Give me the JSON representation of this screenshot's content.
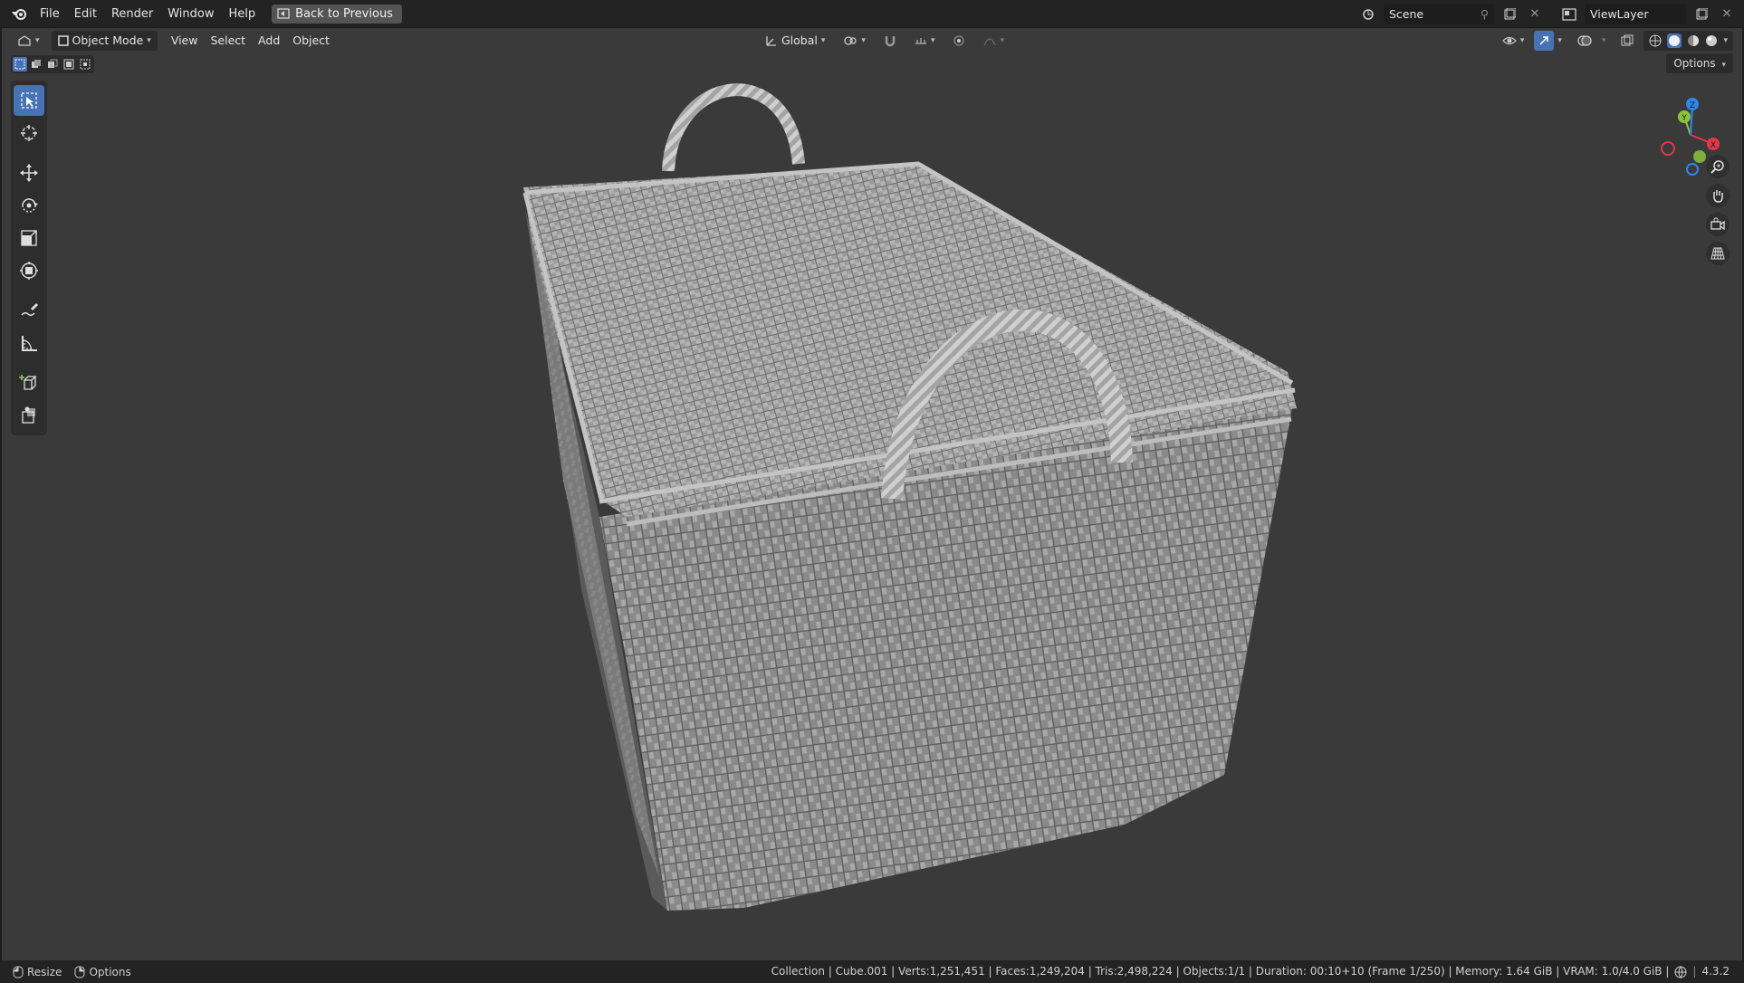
{
  "menu": {
    "items": [
      "File",
      "Edit",
      "Render",
      "Window",
      "Help"
    ],
    "back_button": "Back to Previous"
  },
  "topbar_right": {
    "scene": "Scene",
    "view_layer": "ViewLayer"
  },
  "viewport_header": {
    "mode": "Object Mode",
    "menus": [
      "View",
      "Select",
      "Add",
      "Object"
    ],
    "transform_orientation": "Global",
    "options": "Options"
  },
  "gizmo": {
    "x": "X",
    "y": "Y",
    "z": "Z",
    "colors": {
      "x": "#e2384b",
      "y": "#8ac43d",
      "z": "#2e86ea"
    }
  },
  "status": {
    "left": [
      "Resize",
      "Options"
    ],
    "stats": "Collection | Cube.001 | Verts:1,251,451 | Faces:1,249,204 | Tris:2,498,224 | Objects:1/1 | Duration: 00:10+10 (Frame 1/250) | Memory: 1.64 GiB | VRAM: 1.0/4.0 GiB |",
    "version": "4.3.2"
  },
  "colors": {
    "accent": "#4772b3",
    "viewport_bg": "#3a3a3a"
  }
}
